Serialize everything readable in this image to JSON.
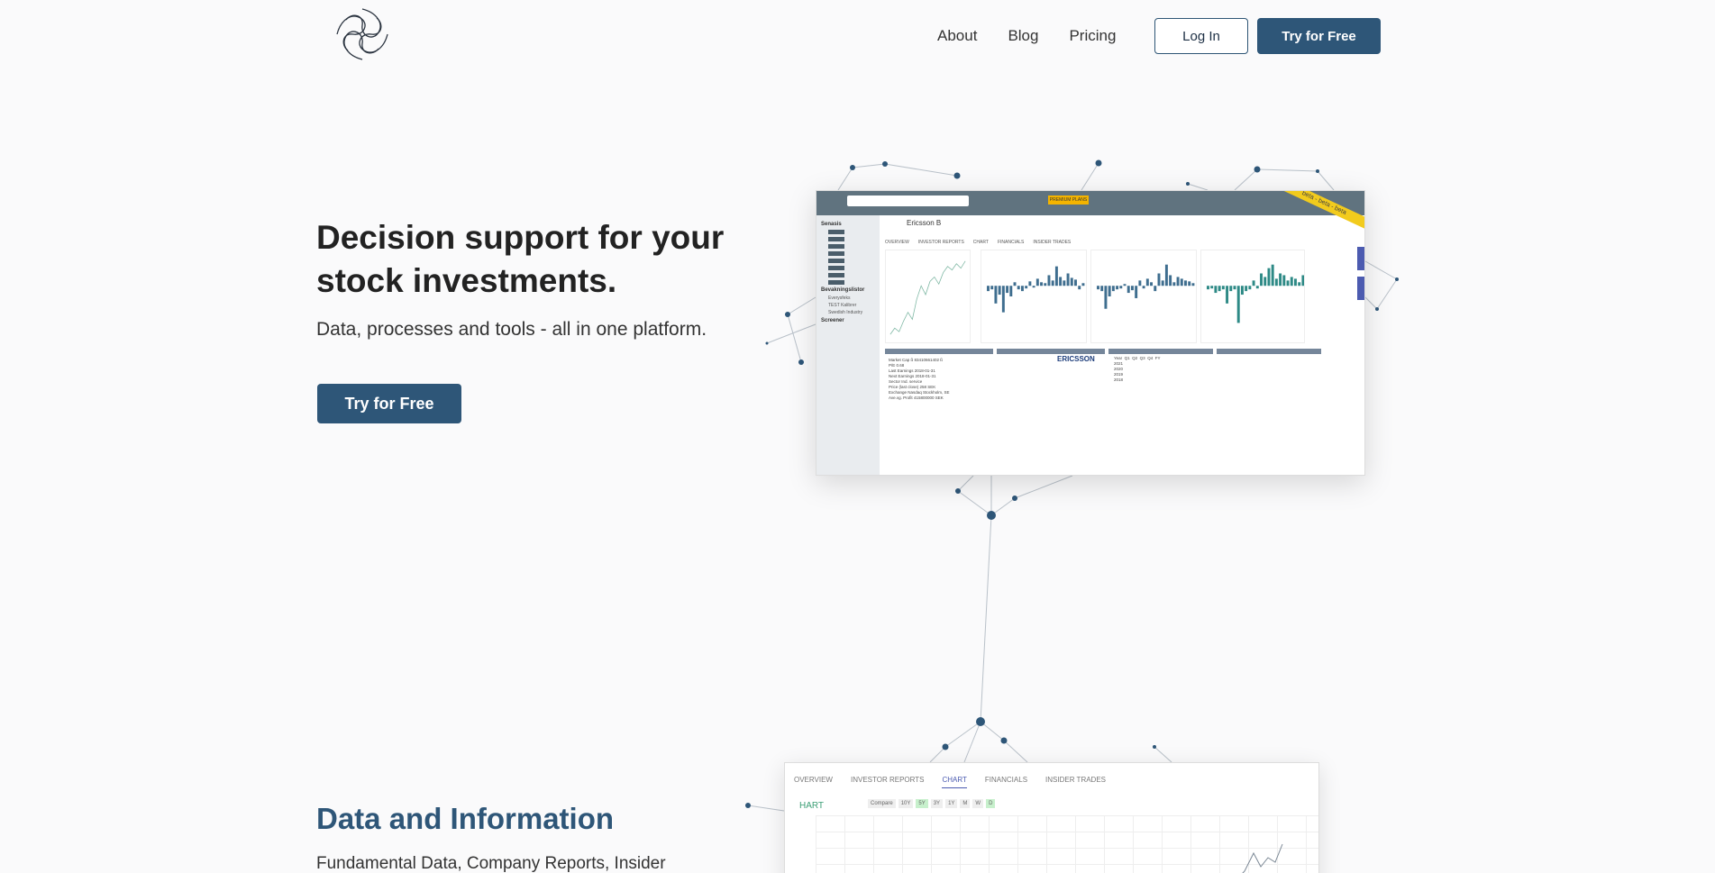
{
  "brand": {
    "logo_icon": "knot-logo-icon"
  },
  "nav": {
    "links": [
      "About",
      "Blog",
      "Pricing"
    ],
    "login_label": "Log In",
    "try_label": "Try for Free"
  },
  "hero": {
    "title": "Decision support for your stock investments.",
    "subtitle": "Data, processes and tools - all in one platform.",
    "cta_label": "Try for Free"
  },
  "preview1": {
    "premium_label": "PREMIUM PLANS",
    "beta_label": "beta - beta - beta",
    "sidebar_sections": [
      "Senasis",
      "Bevakningslistor",
      "Screener"
    ],
    "watchlist_items": [
      "Everysfeks",
      "TEST Kalibrer",
      "Swedish Industry"
    ],
    "company_name": "Ericsson B",
    "tabs": [
      "OVERVIEW",
      "INVESTOR REPORTS",
      "CHART",
      "FINANCIALS",
      "INSIDER TRADES"
    ],
    "logo_text": "ERICSSON",
    "info_rows": [
      {
        "label": "Market Cap",
        "value": "ß 83410661402 ß"
      },
      {
        "label": "P/E",
        "value": "0.68"
      },
      {
        "label": "Last Earnings",
        "value": "2018-01-31"
      },
      {
        "label": "Next Earnings",
        "value": "2018-01-31"
      },
      {
        "label": "Sector",
        "value": "Ind. service"
      },
      {
        "label": "Price (last close)",
        "value": "258 SEK"
      },
      {
        "label": "Exchange",
        "value": "Nasdaq Stockholm, SE"
      },
      {
        "label": "Ave.vg. Profit",
        "value": "415800000 SEK"
      }
    ],
    "report_years": [
      "2021",
      "2020",
      "2019",
      "2018"
    ],
    "report_cols": [
      "Year",
      "Q1",
      "Q2",
      "Q3",
      "Q4",
      "FY"
    ]
  },
  "section2": {
    "title": "Data and Information",
    "subtitle": "Fundamental Data, Company Reports, Insider"
  },
  "preview2": {
    "tabs": [
      "OVERVIEW",
      "INVESTOR REPORTS",
      "CHART",
      "FINANCIALS",
      "INSIDER TRADES"
    ],
    "active_tab": "CHART",
    "chart_label": "HART",
    "compare_label": "Compare",
    "ranges": [
      "10Y",
      "5Y",
      "3Y",
      "1Y"
    ],
    "periods": [
      "M",
      "W",
      "D"
    ]
  },
  "colors": {
    "primary": "#2e5678",
    "accent_green": "#3a9e74",
    "tab_active": "#4a5ab0"
  }
}
